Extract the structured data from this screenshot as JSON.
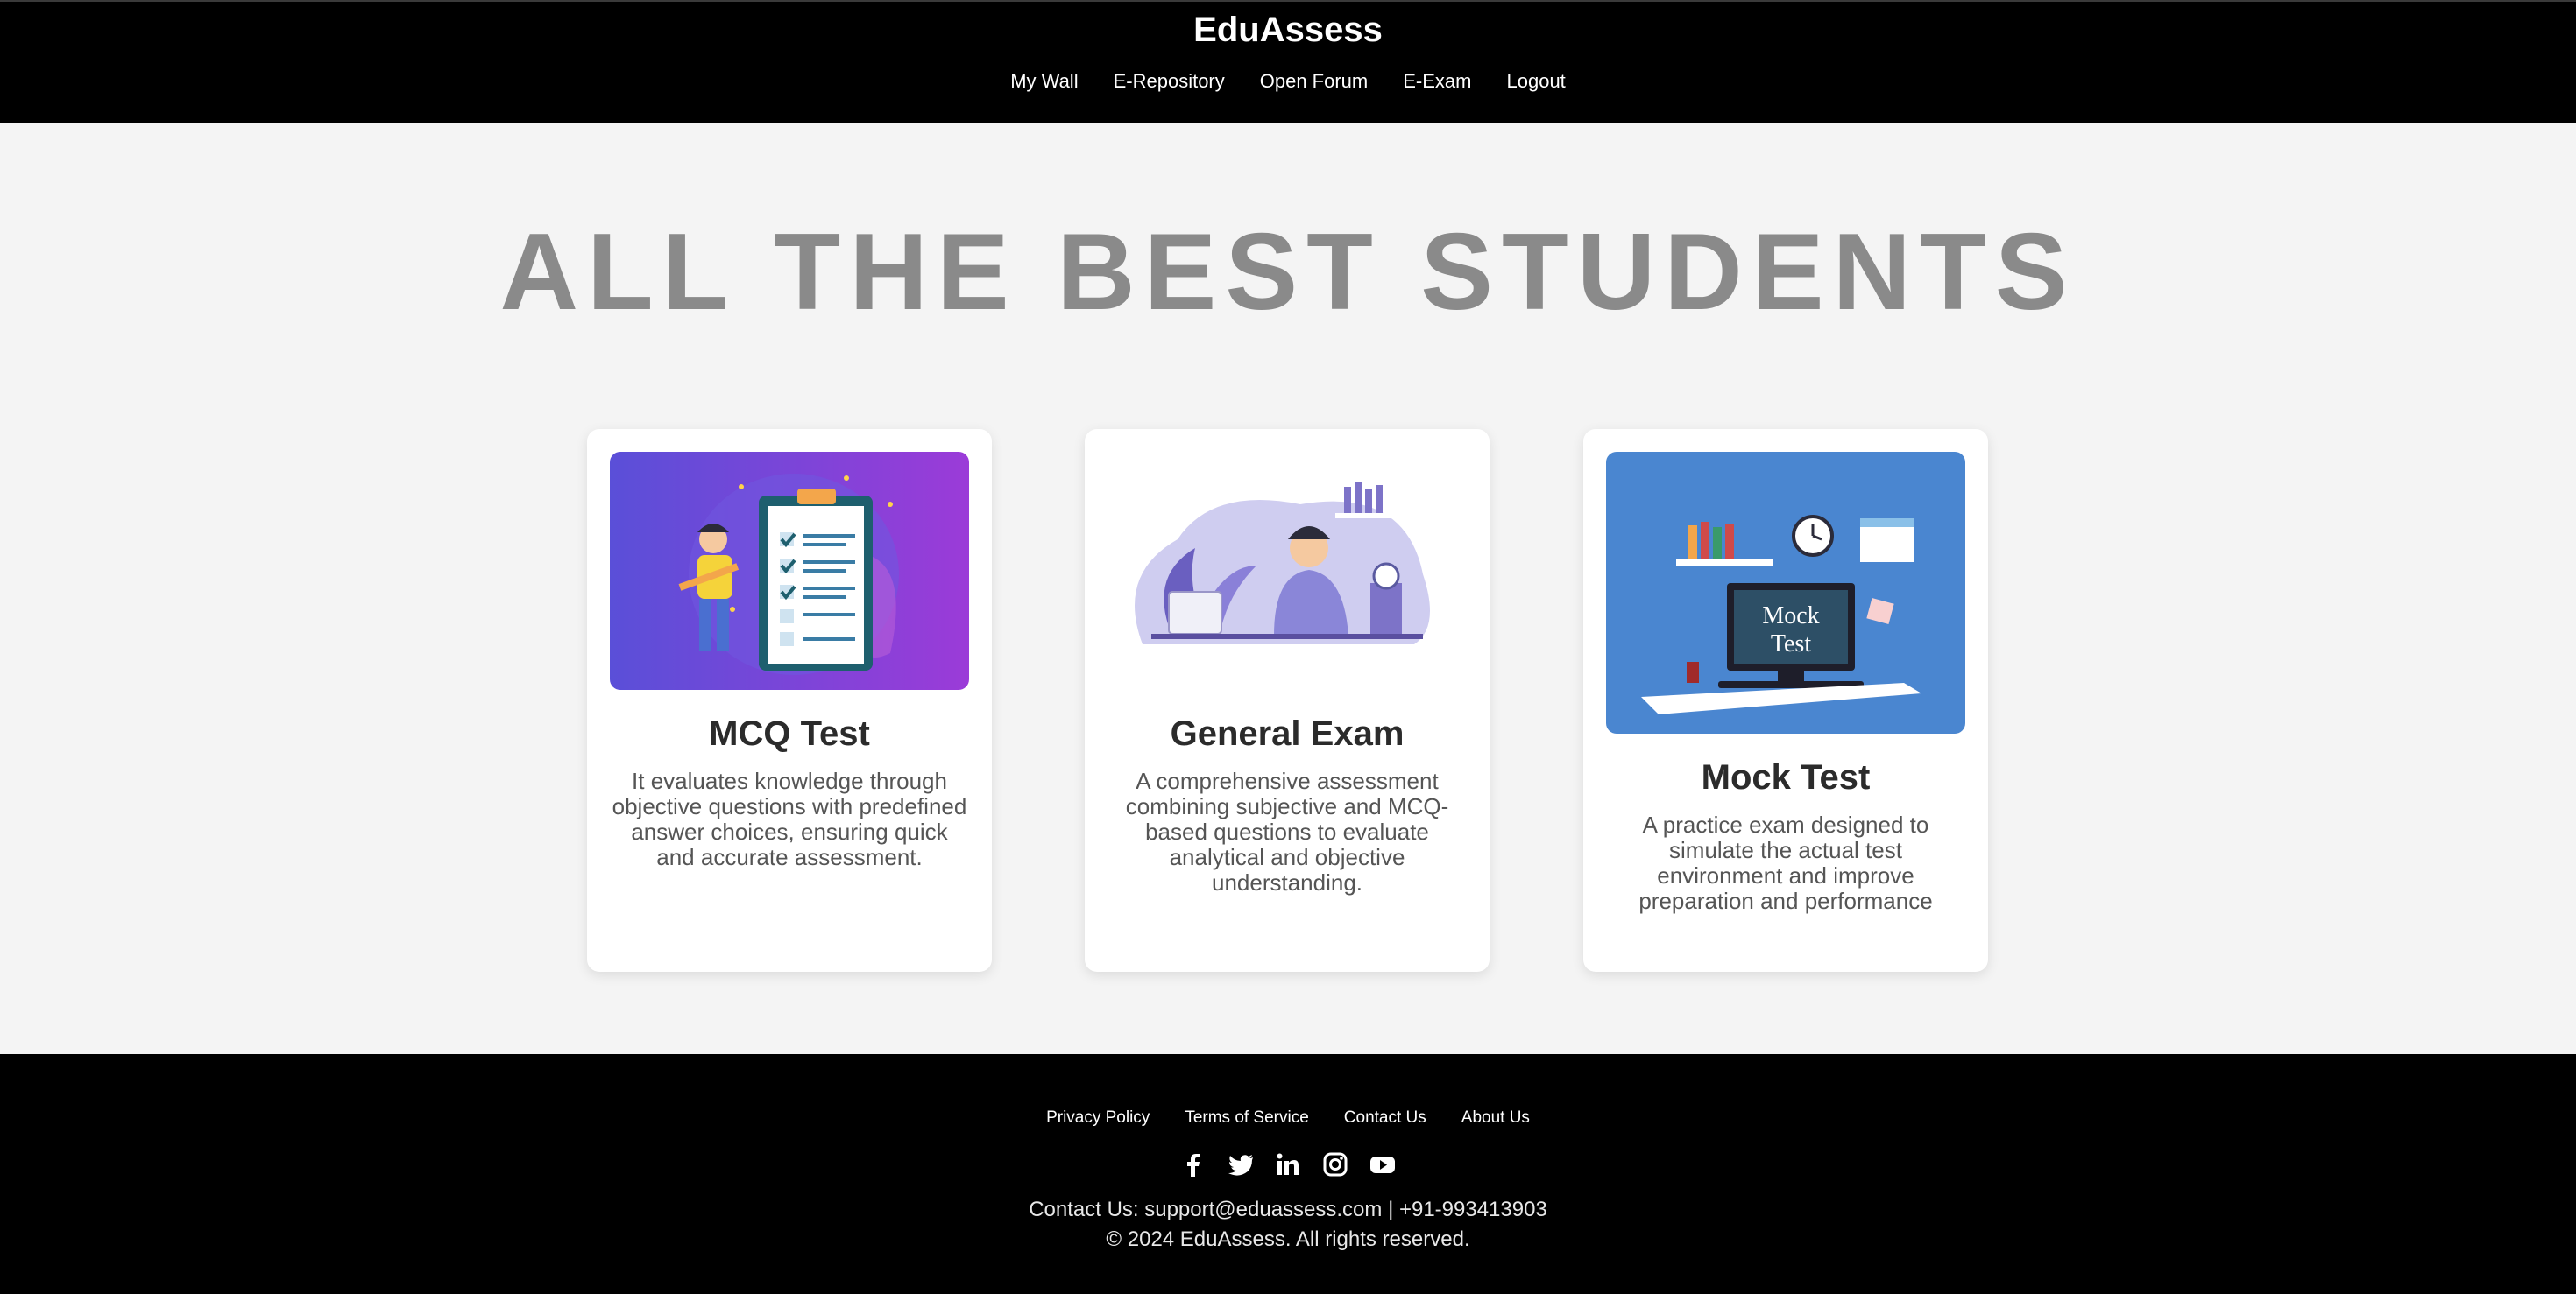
{
  "header": {
    "brand": "EduAssess",
    "nav": [
      "My Wall",
      "E-Repository",
      "Open Forum",
      "E-Exam",
      "Logout"
    ]
  },
  "hero": {
    "title": "ALL THE BEST STUDENTS"
  },
  "cards": [
    {
      "title": "MCQ Test",
      "description": "It evaluates knowledge through objective questions with predefined answer choices, ensuring quick and accurate assessment."
    },
    {
      "title": "General Exam",
      "description": "A comprehensive assessment combining subjective and MCQ-based questions to evaluate analytical and objective understanding."
    },
    {
      "title": "Mock Test",
      "description": "A practice exam designed to simulate the actual test environment and improve preparation and performance",
      "image_text": [
        "Mock",
        "Test"
      ]
    }
  ],
  "footer": {
    "links": [
      "Privacy Policy",
      "Terms of Service",
      "Contact Us",
      "About Us"
    ],
    "social_icons": [
      "facebook-icon",
      "twitter-icon",
      "linkedin-icon",
      "instagram-icon",
      "youtube-icon"
    ],
    "contact": "Contact Us: support@eduassess.com | +91-993413903",
    "copyright": "© 2024 EduAssess. All rights reserved."
  },
  "colors": {
    "header_bg": "#000000",
    "page_bg": "#f4f4f4",
    "hero_text": "#8a8a8a",
    "mcq_gradient": [
      "#5a4fd8",
      "#9b3bd8"
    ],
    "mock_bg": "#4a86d0"
  }
}
